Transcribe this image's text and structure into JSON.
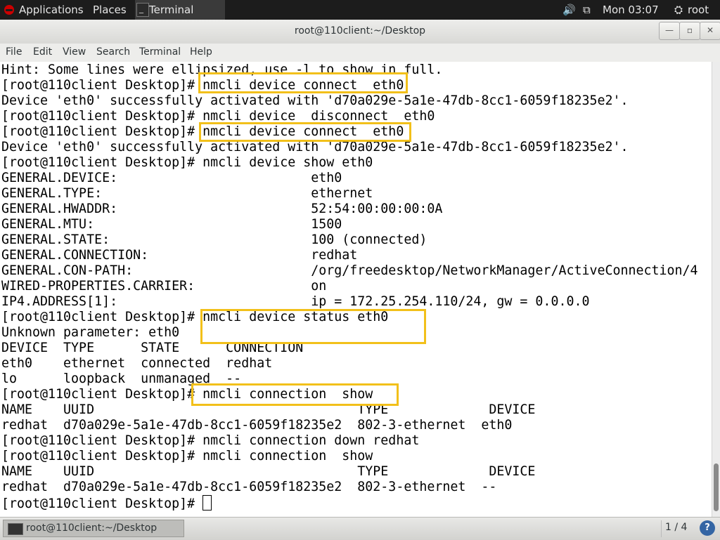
{
  "topbar": {
    "applications": "Applications",
    "places": "Places",
    "terminal": "Terminal",
    "volume_icon": "🔊",
    "network_icon": "⧉",
    "clock": "Mon 03:07",
    "user_icon": "⛭",
    "user": "root"
  },
  "window": {
    "title": "root@110client:~/Desktop",
    "minimize": "—",
    "maximize": "▫",
    "close": "✕"
  },
  "menubar": {
    "file": "File",
    "edit": "Edit",
    "view": "View",
    "search": "Search",
    "terminal": "Terminal",
    "help": "Help"
  },
  "terminal": {
    "lines": [
      "Hint: Some lines were ellipsized, use -l to show in full.",
      "[root@110client Desktop]# nmcli device connect  eth0",
      "Device 'eth0' successfully activated with 'd70a029e-5a1e-47db-8cc1-6059f18235e2'.",
      "[root@110client Desktop]# nmcli device  disconnect  eth0",
      "[root@110client Desktop]# nmcli device connect  eth0",
      "Device 'eth0' successfully activated with 'd70a029e-5a1e-47db-8cc1-6059f18235e2'.",
      "[root@110client Desktop]# nmcli device show eth0",
      "GENERAL.DEVICE:                         eth0",
      "GENERAL.TYPE:                           ethernet",
      "GENERAL.HWADDR:                         52:54:00:00:00:0A",
      "GENERAL.MTU:                            1500",
      "GENERAL.STATE:                          100 (connected)",
      "GENERAL.CONNECTION:                     redhat",
      "GENERAL.CON-PATH:                       /org/freedesktop/NetworkManager/ActiveConnection/4",
      "WIRED-PROPERTIES.CARRIER:               on",
      "IP4.ADDRESS[1]:                         ip = 172.25.254.110/24, gw = 0.0.0.0",
      "[root@110client Desktop]# nmcli device status eth0",
      "Unknown parameter: eth0",
      "DEVICE  TYPE      STATE      CONNECTION",
      "eth0    ethernet  connected  redhat",
      "lo      loopback  unmanaged  --",
      "[root@110client Desktop]# nmcli connection  show",
      "NAME    UUID                                  TYPE             DEVICE",
      "redhat  d70a029e-5a1e-47db-8cc1-6059f18235e2  802-3-ethernet  eth0",
      "[root@110client Desktop]# nmcli connection down redhat",
      "[root@110client Desktop]# nmcli connection  show",
      "NAME    UUID                                  TYPE             DEVICE",
      "redhat  d70a029e-5a1e-47db-8cc1-6059f18235e2  802-3-ethernet  --"
    ],
    "prompt": "[root@110client Desktop]# "
  },
  "taskbar": {
    "window_label": "root@110client:~/Desktop",
    "workspace": "1 / 4",
    "help": "?"
  },
  "colors": {
    "highlight": "#f2c01a",
    "terminal_bg": "#ffffff",
    "topbar_bg": "#1c1c1c"
  }
}
